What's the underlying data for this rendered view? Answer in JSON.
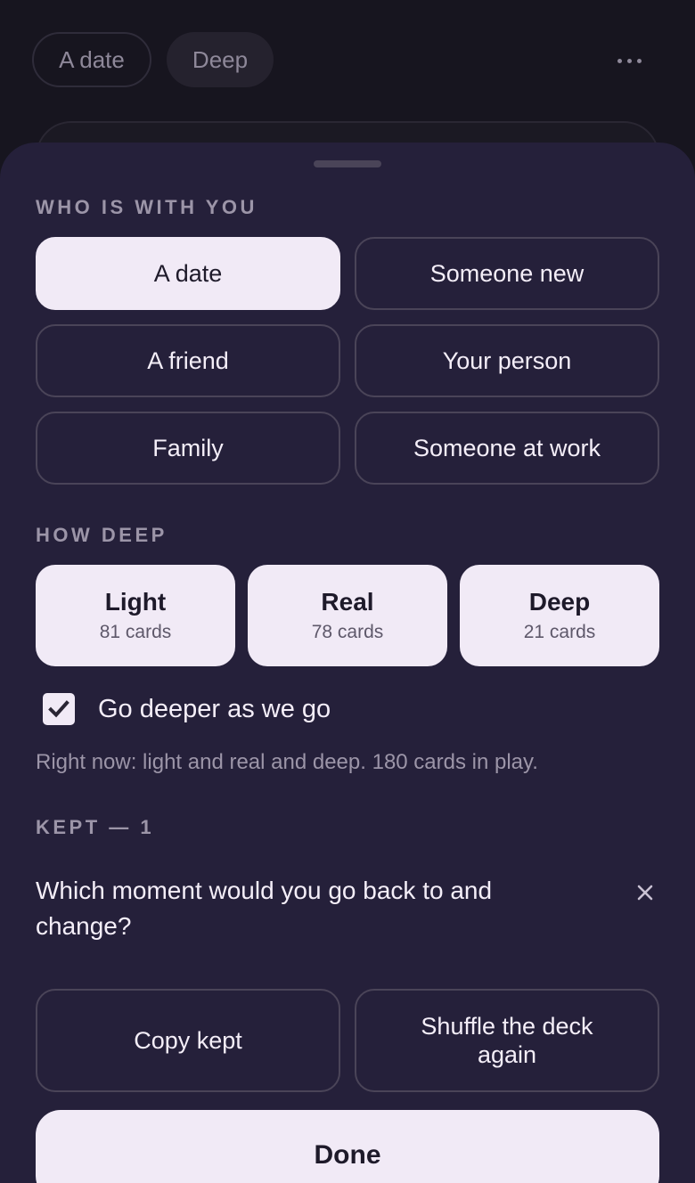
{
  "background": {
    "chips": [
      "A date",
      "Deep"
    ],
    "more_icon": "more-horizontal-icon"
  },
  "sheet": {
    "who_label": "WHO IS WITH YOU",
    "who_options": [
      "A date",
      "Someone new",
      "A friend",
      "Your person",
      "Family",
      "Someone at work"
    ],
    "who_selected": "A date",
    "depth_label": "HOW DEEP",
    "depths": [
      {
        "name": "Light",
        "count": "81 cards"
      },
      {
        "name": "Real",
        "count": "78 cards"
      },
      {
        "name": "Deep",
        "count": "21 cards"
      }
    ],
    "go_deeper": {
      "label": "Go deeper as we go",
      "checked": true
    },
    "status": "Right now: light and real and deep. 180 cards in play.",
    "kept_label": "KEPT — 1",
    "kept_items": [
      "Which moment would you go back to and change?"
    ],
    "actions": {
      "copy": "Copy kept",
      "shuffle": "Shuffle the deck again",
      "done": "Done"
    }
  },
  "colors": {
    "sheet_bg": "#25203a",
    "page_bg": "#17151f",
    "selected_bg": "#f1eaf6",
    "border": "#4a4458",
    "muted_text": "#9c95a8"
  }
}
